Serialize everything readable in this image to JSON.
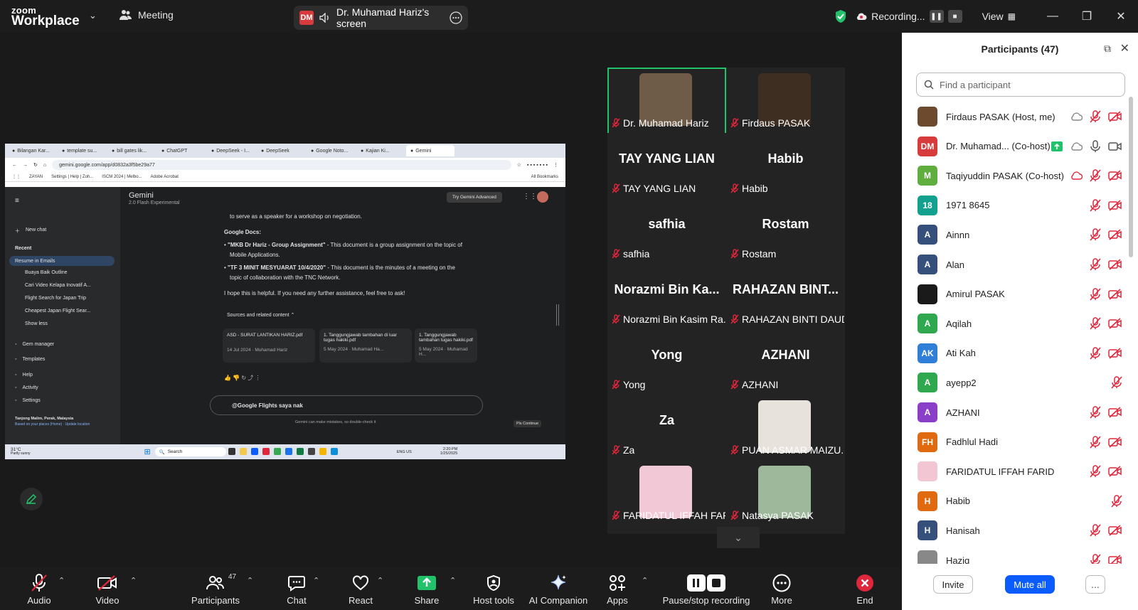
{
  "app": {
    "brand_line1": "zoom",
    "brand_line2": "Workplace",
    "meeting_label": "Meeting"
  },
  "share": {
    "initials": "DM",
    "label": "Dr. Muhamad Hariz's screen"
  },
  "recording": {
    "label": "Recording...",
    "view_label": "View"
  },
  "shared_screen": {
    "tabs": [
      "Bilangan Kar...",
      "template su...",
      "bill gates lik...",
      "ChatGPT",
      "DeepSeek - I...",
      "DeepSeek",
      "Google Noto...",
      "Kajian Ki...",
      "Gemini"
    ],
    "url": "gemini.google.com/app/d0832a3f5be29a77",
    "bookmarks": [
      "ZAYAN",
      "Settings | Help | Zoh...",
      "ISCM 2024 | Melbo...",
      "Adobe Acrobat",
      "All Bookmarks"
    ],
    "gemini": {
      "title": "Gemini",
      "subtitle": "2.0 Flash Experimental",
      "try_advanced": "Try Gemini Advanced",
      "new_chat": "New chat",
      "recent_label": "Recent",
      "recent": [
        "Resume in Emails",
        "Buaya Baik Outline",
        "Cari Video Kelapa Inovatif A...",
        "Flight Search for Japan Trip",
        "Cheapest Japan Flight Sear...",
        "Show less"
      ],
      "side_bottom": [
        "Gem manager",
        "Templates",
        "Help",
        "Activity",
        "Settings"
      ],
      "location": "Tanjong Malim, Perak, Malaysia",
      "location_sub": "Based on your places (Home) · Update location",
      "line1": "to serve as a speaker for a workshop on negotiation.",
      "heading": "Google Docs:",
      "b1_bold": "\"MKB Dr Hariz - Group Assignment\"",
      "b1_rest": " - This document is a group assignment on the topic of",
      "b1_line2": "Mobile Applications.",
      "b2_bold": "\"TF 3 MINIT MESYUARAT 10/4/2020\"",
      "b2_rest": " - This document is the minutes of a meeting on the",
      "b2_line2": "topic of collaboration with the TNC Network.",
      "closing": "I hope this is helpful. If you need any further assistance, feel free to ask!",
      "sources_label": "Sources and related content",
      "sources": [
        {
          "title": "ASD - SURAT LANTIKAN HARIZ.pdf",
          "meta": "14 Jul 2024 · Muhamad Hariz"
        },
        {
          "title": "1. Tanggungjawab tambahan di luar tugas hakiki.pdf",
          "meta": "5 May 2024 · Muhamad Ha..."
        },
        {
          "title": "1. Tanggungjawab tambahan tugas hakiki.pdf",
          "meta": "5 May 2024 · Muhamad H..."
        }
      ],
      "input_value": "@Google Flights saya nak",
      "disclaimer": "Gemini can make mistakes, so double-check it",
      "pls_continue": "Pls Continue"
    },
    "taskbar": {
      "weather": "31°C",
      "weather_sub": "Partly sunny",
      "search": "Search",
      "lang": "ENG US",
      "time": "2:20 PM",
      "date": "1/25/2025"
    }
  },
  "gallery": [
    {
      "name": "Dr. Muhamad Hariz",
      "big": "",
      "photo": true
    },
    {
      "name": "Firdaus PASAK",
      "big": "",
      "photo": true
    },
    {
      "name": "TAY YANG LIAN",
      "big": "TAY YANG LIAN"
    },
    {
      "name": "Habib",
      "big": "Habib"
    },
    {
      "name": "safhia",
      "big": "safhia"
    },
    {
      "name": "Rostam",
      "big": "Rostam"
    },
    {
      "name": "Norazmi Bin Kasim Ra...",
      "big": "Norazmi Bin Ka..."
    },
    {
      "name": "RAHAZAN BINTI DAUD",
      "big": "RAHAZAN BINT..."
    },
    {
      "name": "Yong",
      "big": "Yong"
    },
    {
      "name": "AZHANI",
      "big": "AZHANI"
    },
    {
      "name": "Za",
      "big": "Za"
    },
    {
      "name": "PUAN ASMAR MAIZU...",
      "big": "",
      "photo": true
    },
    {
      "name": "FARIDATUL IFFAH FARID",
      "big": "",
      "photo": true
    },
    {
      "name": "Natasya PASAK",
      "big": "",
      "photo": true
    }
  ],
  "participants": {
    "title": "Participants (47)",
    "search_placeholder": "Find a participant",
    "list": [
      {
        "initials": "",
        "name": "Firdaus PASAK (Host, me)",
        "color": "#6b4a2e"
      },
      {
        "initials": "DM",
        "name": "Dr. Muhamad... (Co-host)",
        "color": "#d83b3b"
      },
      {
        "initials": "M",
        "name": "Taqiyuddin PASAK (Co-host)",
        "color": "#5fae3f"
      },
      {
        "initials": "18",
        "name": "1971 8645",
        "color": "#12a08f"
      },
      {
        "initials": "A",
        "name": "Ainnn",
        "color": "#35507a"
      },
      {
        "initials": "A",
        "name": "Alan",
        "color": "#35507a"
      },
      {
        "initials": "",
        "name": "Amirul PASAK",
        "color": "#1a1a1a"
      },
      {
        "initials": "A",
        "name": "Aqilah",
        "color": "#2fa84f"
      },
      {
        "initials": "AK",
        "name": "Ati Kah",
        "color": "#2f7fd8"
      },
      {
        "initials": "A",
        "name": "ayepp2",
        "color": "#2fa84f"
      },
      {
        "initials": "A",
        "name": "AZHANI",
        "color": "#8a3fc8"
      },
      {
        "initials": "FH",
        "name": "Fadhlul Hadi",
        "color": "#e06a10"
      },
      {
        "initials": "",
        "name": "FARIDATUL IFFAH FARID",
        "color": "#f3c6d4"
      },
      {
        "initials": "H",
        "name": "Habib",
        "color": "#e06a10"
      },
      {
        "initials": "H",
        "name": "Hanisah",
        "color": "#35507a"
      },
      {
        "initials": "",
        "name": "Haziq",
        "color": "#888888"
      }
    ],
    "invite": "Invite",
    "mute_all": "Mute all",
    "more": "..."
  },
  "toolbar": {
    "audio": "Audio",
    "video": "Video",
    "participants": "Participants",
    "participants_count": "47",
    "chat": "Chat",
    "react": "React",
    "share": "Share",
    "host_tools": "Host tools",
    "ai_companion": "AI Companion",
    "apps": "Apps",
    "pause_recording": "Pause/stop recording",
    "more": "More",
    "end": "End"
  },
  "colors": {
    "accent": "#0b5cff",
    "share_green": "#22c26b",
    "end_red": "#e0263b",
    "muted_red": "#e0263b"
  }
}
